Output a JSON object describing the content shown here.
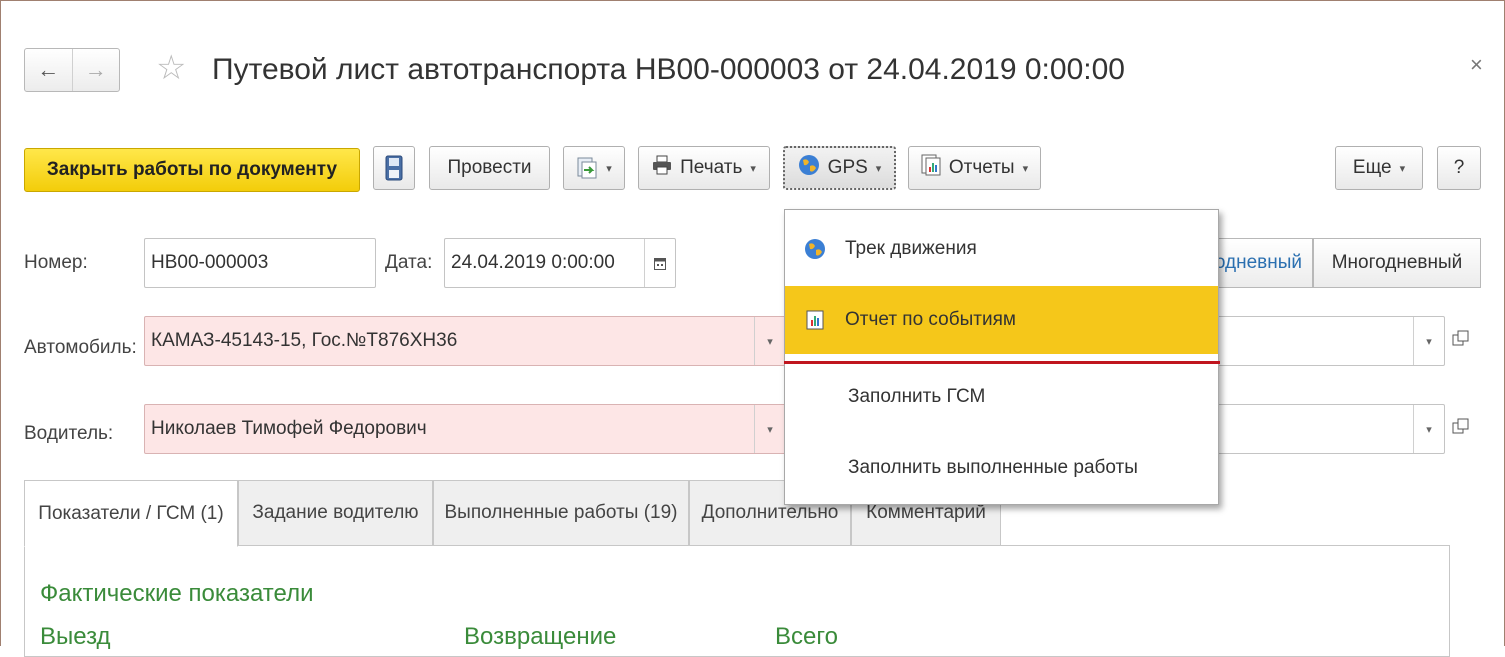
{
  "window": {
    "title": "Путевой лист автотранспорта НВ00-000003 от 24.04.2019 0:00:00",
    "close_glyph": "×"
  },
  "nav": {
    "back_glyph": "←",
    "forward_glyph": "→",
    "star_glyph": "☆"
  },
  "toolbar": {
    "close_works_label": "Закрыть работы по документу",
    "post_label": "Провести",
    "print_label": "Печать",
    "gps_label": "GPS",
    "reports_label": "Отчеты",
    "more_label": "Еще",
    "help_label": "?",
    "caret": "▾"
  },
  "fields": {
    "number_label": "Номер:",
    "number_value": "НВ00-000003",
    "date_label": "Дата:",
    "date_value": "24.04.2019  0:00:00",
    "car_label": "Автомобиль:",
    "car_value": "КАМАЗ-45143-15, Гос.№Т876ХН36",
    "driver_label": "Водитель:",
    "driver_value": "Николаев Тимофей Федорович"
  },
  "mode_toggle": {
    "single_partial": "днодневный",
    "multi": "Многодневный"
  },
  "tabs": [
    {
      "label": "Показатели / ГСМ (1)"
    },
    {
      "label": "Задание водителю"
    },
    {
      "label": "Выполненные работы (19)"
    },
    {
      "label": "Дополнительно"
    },
    {
      "label": "Комментарий"
    }
  ],
  "panel": {
    "section_title": "Фактические показатели",
    "col_departure": "Выезд",
    "col_return": "Возвращение",
    "col_total": "Всего"
  },
  "gps_menu": {
    "items": [
      {
        "label": "Трек движения",
        "icon": "globe-icon"
      },
      {
        "label": "Отчет по событиям",
        "icon": "report-icon"
      },
      {
        "label": "Заполнить ГСМ"
      },
      {
        "label": "Заполнить выполненные работы"
      }
    ]
  },
  "colors": {
    "accent_yellow": "#f5c71a",
    "required_field_bg": "#fde6e6",
    "section_green": "#3a8b3a",
    "annotation_red": "#c0151e"
  }
}
